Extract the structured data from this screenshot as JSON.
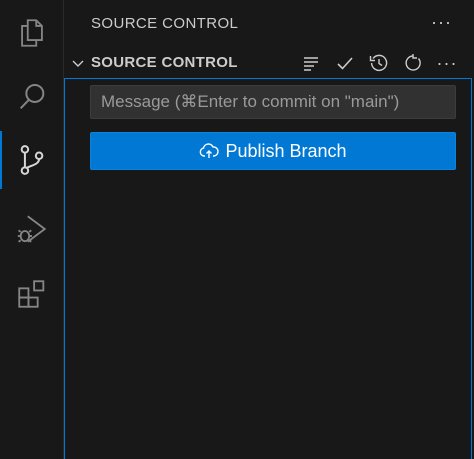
{
  "sidebar": {
    "title": "SOURCE CONTROL",
    "more_label": "···"
  },
  "section": {
    "title": "SOURCE CONTROL",
    "actions": [
      "list-flat-icon",
      "check-icon",
      "history-icon",
      "refresh-icon",
      "ellipsis-icon"
    ],
    "more_label": "···"
  },
  "commit": {
    "placeholder": "Message (⌘Enter to commit on \"main\")",
    "value": ""
  },
  "publish": {
    "label": "Publish Branch",
    "icon": "cloud-upload-icon"
  },
  "activity_bar": {
    "items": [
      "explorer-icon",
      "search-icon",
      "source-control-icon",
      "run-debug-icon",
      "extensions-icon"
    ],
    "active": "source-control-icon"
  },
  "colors": {
    "accent": "#0078d4",
    "background": "#181818",
    "foreground": "#cccccc"
  }
}
